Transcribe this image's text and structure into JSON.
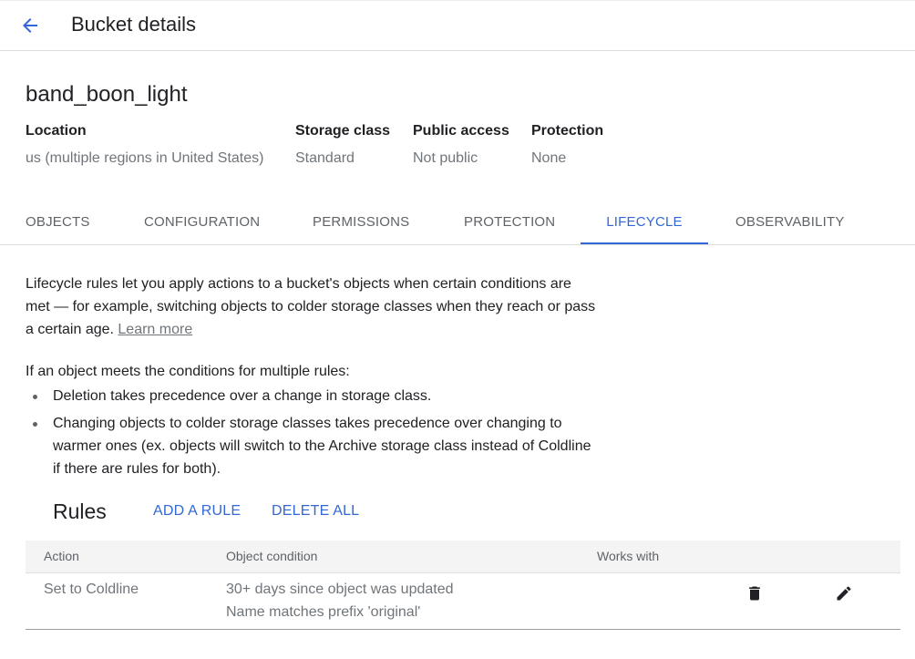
{
  "header": {
    "title": "Bucket details",
    "back_icon": "arrow-back-icon"
  },
  "bucket": {
    "name": "band_boon_light",
    "location_label": "Location",
    "location_value": "us (multiple regions in United States)",
    "storage_class_label": "Storage class",
    "storage_class_value": "Standard",
    "public_access_label": "Public access",
    "public_access_value": "Not public",
    "protection_label": "Protection",
    "protection_value": "None"
  },
  "tabs": [
    {
      "label": "OBJECTS"
    },
    {
      "label": "CONFIGURATION"
    },
    {
      "label": "PERMISSIONS"
    },
    {
      "label": "PROTECTION"
    },
    {
      "label": "LIFECYCLE",
      "active": true
    },
    {
      "label": "OBSERVABILITY"
    }
  ],
  "lifecycle": {
    "intro_line1": "Lifecycle rules let you apply actions to a bucket's objects when certain conditions are",
    "intro_line2": "met — for example, switching objects to colder storage classes when they reach or pass",
    "intro_line3": "a certain age.",
    "learn_more": "Learn more",
    "multi_rules_heading": "If an object meets the conditions for multiple rules:",
    "bullet1": "Deletion takes precedence over a change in storage class.",
    "bullet2_line1": "Changing objects to colder storage classes takes precedence over changing to",
    "bullet2_line2": "warmer ones (ex. objects will switch to the Archive storage class instead of Coldline",
    "bullet2_line3": "if there are rules for both)."
  },
  "rules": {
    "title": "Rules",
    "add_rule": "ADD A RULE",
    "delete_all": "DELETE ALL",
    "columns": {
      "action": "Action",
      "condition": "Object condition",
      "works_with": "Works with"
    },
    "rows": [
      {
        "action": "Set to Coldline",
        "condition_line1": "30+ days since object was updated",
        "condition_line2": "Name matches prefix 'original'",
        "delete_icon": "trash-icon",
        "edit_icon": "pencil-icon"
      }
    ]
  },
  "colors": {
    "accent": "#3367d6",
    "text_primary": "#202124",
    "text_secondary": "#70757a"
  }
}
